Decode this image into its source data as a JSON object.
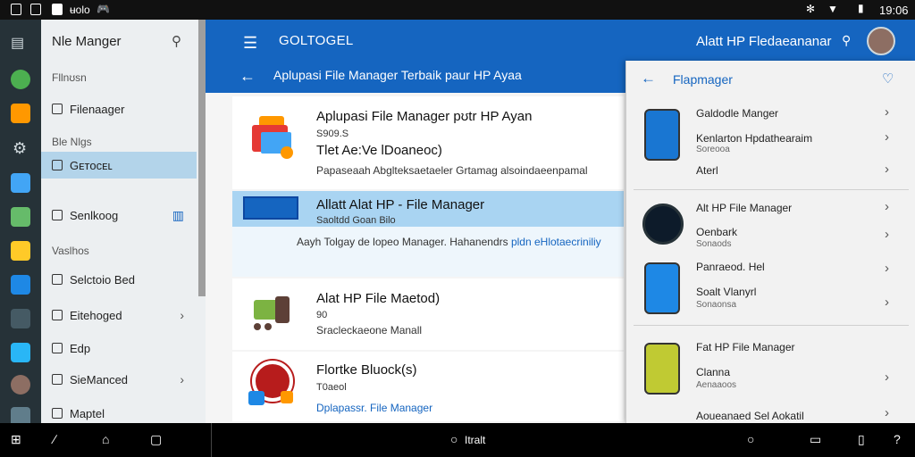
{
  "status": {
    "left_text": "ʉolo",
    "time": "19:06"
  },
  "drawer": {
    "title": "Nle Manger",
    "sections": [
      "Fllnʊsn",
      "Ble Nlgs",
      "Vaslhos"
    ],
    "items": [
      {
        "label": "Filenaager"
      },
      {
        "label": "Gᴇᴛᴏᴄᴇʟ"
      },
      {
        "label": "Senlkoog"
      },
      {
        "label": "Selctoio Bed"
      },
      {
        "label": "Eitehoged"
      },
      {
        "label": "Edp"
      },
      {
        "label": "SieManced"
      },
      {
        "label": "Maptel"
      }
    ]
  },
  "appbar": {
    "title": "GOLTOGEL",
    "subtitle": "Aplupasi File Manager Terbaik paur HP Ayaa",
    "right_text": "Alatt HP Fledaeananar"
  },
  "cards": [
    {
      "title": "Aplupasi File Manager pʊtr HP Ayan",
      "meta": "S909.S",
      "line2": "Tlet Ae:Ve lDoaneoc)",
      "desc": "Papaseaah Abglteksaetaeler Grtamag alsoindaeenpamal"
    },
    {
      "title": "Allatt Alat HP - File Manager",
      "meta": "Saoltdd Goan Bilo",
      "banner": "Aayh  Tolgay  de lopeo Manager. Hahanendrs",
      "banner_link": "pldn eHlotaecriniliy"
    },
    {
      "title": "Alat HP File Maetod)",
      "meta": "90",
      "desc": "Sracleckaeone Manall"
    },
    {
      "title": "Flortke Bluock(s)",
      "meta": "T0aeol",
      "desc_link": "Dplapassr. File Manager"
    }
  ],
  "rpanel": {
    "title": "Flapmager",
    "groups": [
      {
        "rows": [
          "Galdodle Manger",
          "Kenlarton Hpdathearaim",
          "Aterl"
        ],
        "sub": "Soreooa"
      },
      {
        "rows": [
          "Alt HP File Manager",
          "Oenbark",
          "Sonaods"
        ],
        "sub": ""
      },
      {
        "rows": [
          "Panraeod. Hel",
          "Soalt Vlanyrl",
          "Sonaonsa"
        ],
        "sub": ""
      },
      {
        "rows": [
          "Fat HP File Manager",
          "Clanna",
          "Aenaaoos"
        ],
        "sub": ""
      },
      {
        "rows": [
          "Aoueanaed Sel Aokatil"
        ],
        "sub": ""
      }
    ]
  },
  "navbar": {
    "center_text": "Itralt"
  }
}
